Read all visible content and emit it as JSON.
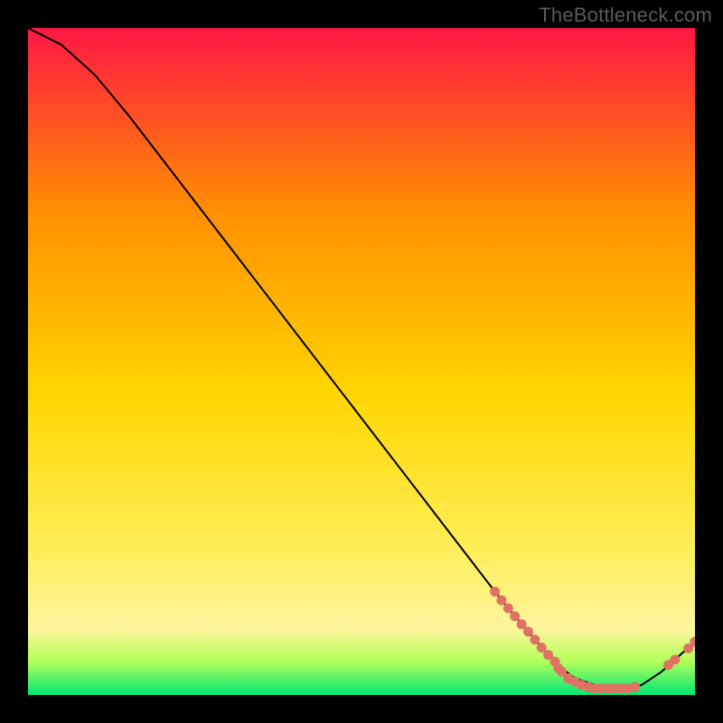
{
  "watermark": "TheBottleneck.com",
  "colors": {
    "gradient_top": "#ff1744",
    "gradient_upper_mid": "#ff9100",
    "gradient_mid": "#ffd600",
    "gradient_lower": "#ffee58",
    "gradient_pale": "#fff59d",
    "gradient_near_bottom": "#b2ff59",
    "gradient_bottom": "#00e676",
    "line": "#000000",
    "marker": "#e07263"
  },
  "chart_data": {
    "type": "line",
    "title": "",
    "xlabel": "",
    "ylabel": "",
    "xlim": [
      0,
      100
    ],
    "ylim": [
      0,
      100
    ],
    "series": [
      {
        "name": "bottleneck-curve",
        "x": [
          0,
          5,
          10,
          15,
          20,
          25,
          30,
          35,
          40,
          45,
          50,
          55,
          60,
          65,
          70,
          72,
          75,
          78,
          80,
          82,
          85,
          88,
          90,
          92,
          95,
          100
        ],
        "y": [
          100,
          97.5,
          93,
          87,
          80.5,
          74,
          67.5,
          61,
          54.5,
          48,
          41.5,
          35,
          28.5,
          22,
          15.5,
          13,
          9.5,
          6,
          4,
          2.5,
          1.5,
          1,
          1,
          1.5,
          3.5,
          8
        ]
      }
    ],
    "markers": [
      {
        "name": "highlighted-points",
        "points": [
          {
            "x": 70,
            "y": 15.5
          },
          {
            "x": 71,
            "y": 14.2
          },
          {
            "x": 72,
            "y": 13
          },
          {
            "x": 73,
            "y": 11.8
          },
          {
            "x": 74,
            "y": 10.6
          },
          {
            "x": 75,
            "y": 9.5
          },
          {
            "x": 76,
            "y": 8.3
          },
          {
            "x": 77,
            "y": 7.1
          },
          {
            "x": 78,
            "y": 6
          },
          {
            "x": 79,
            "y": 5
          },
          {
            "x": 79.5,
            "y": 4
          },
          {
            "x": 80,
            "y": 3.5
          },
          {
            "x": 81,
            "y": 2.5
          },
          {
            "x": 82,
            "y": 2
          },
          {
            "x": 83,
            "y": 1.5
          },
          {
            "x": 84,
            "y": 1.2
          },
          {
            "x": 85,
            "y": 1
          },
          {
            "x": 86,
            "y": 1
          },
          {
            "x": 87,
            "y": 1
          },
          {
            "x": 88,
            "y": 1
          },
          {
            "x": 89,
            "y": 1
          },
          {
            "x": 90,
            "y": 1
          },
          {
            "x": 91,
            "y": 1.2
          },
          {
            "x": 96,
            "y": 4.5
          },
          {
            "x": 97,
            "y": 5.3
          },
          {
            "x": 99,
            "y": 7
          },
          {
            "x": 100,
            "y": 8
          }
        ]
      }
    ]
  }
}
